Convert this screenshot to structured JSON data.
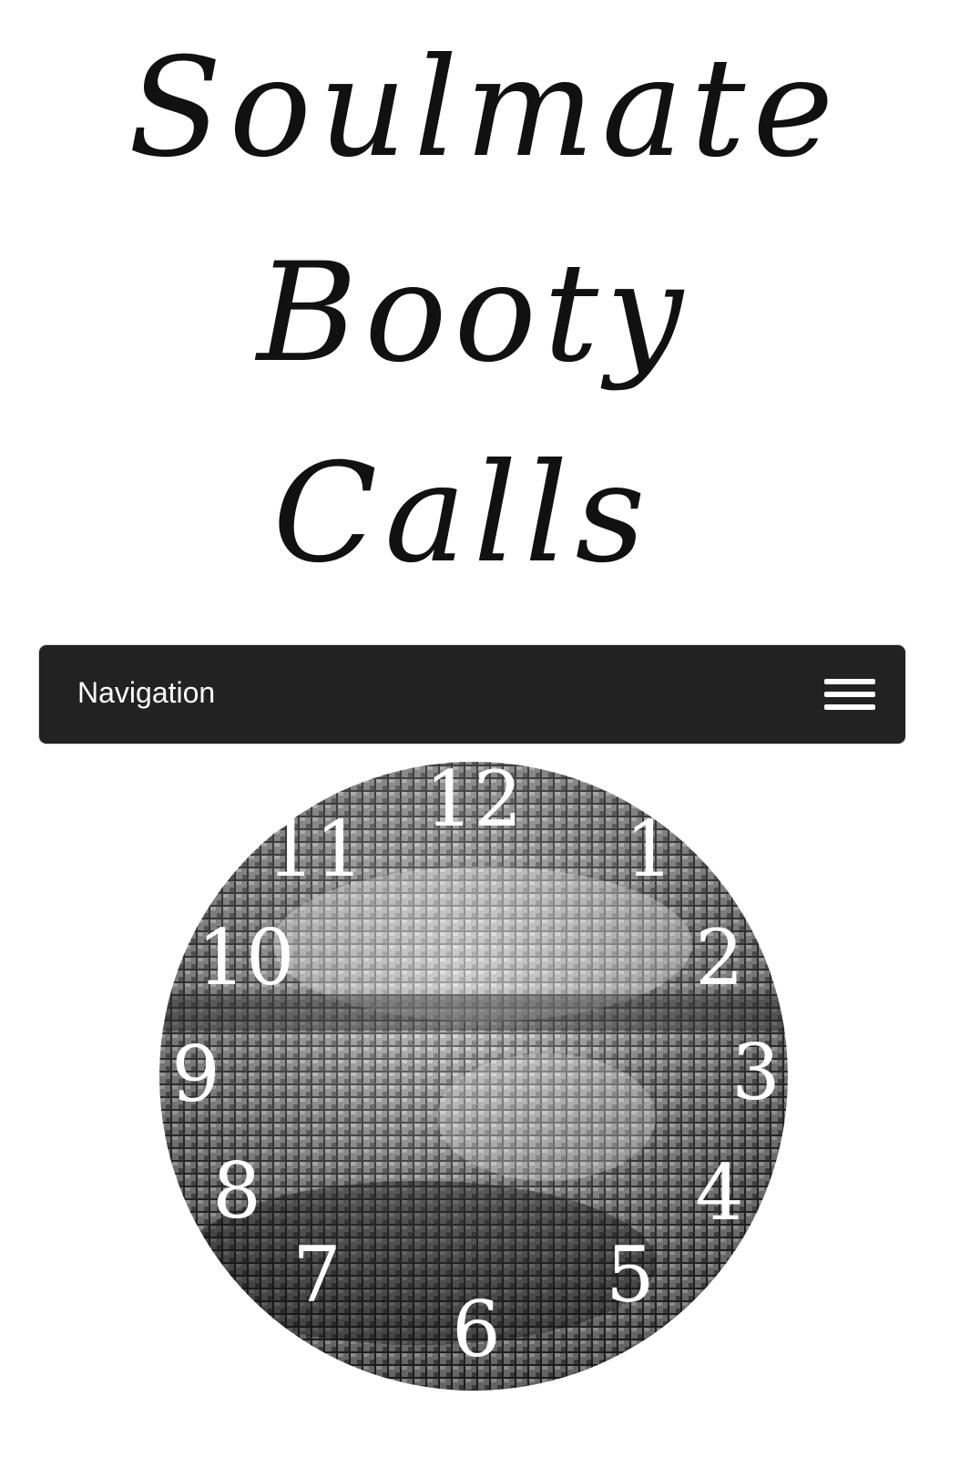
{
  "header": {
    "title_lines": [
      "Soulmate",
      "Booty",
      "Calls"
    ]
  },
  "navigation": {
    "label": "Navigation",
    "toggle_icon": "hamburger-menu-icon"
  },
  "clock": {
    "image": "disco-ball",
    "numerals": [
      "12",
      "1",
      "2",
      "3",
      "4",
      "5",
      "6",
      "7",
      "8",
      "9",
      "10",
      "11"
    ]
  },
  "colors": {
    "background": "#ffffff",
    "title": "#111111",
    "navbar": "#222222",
    "nav_text": "#ffffff",
    "numerals": "#ffffff"
  }
}
